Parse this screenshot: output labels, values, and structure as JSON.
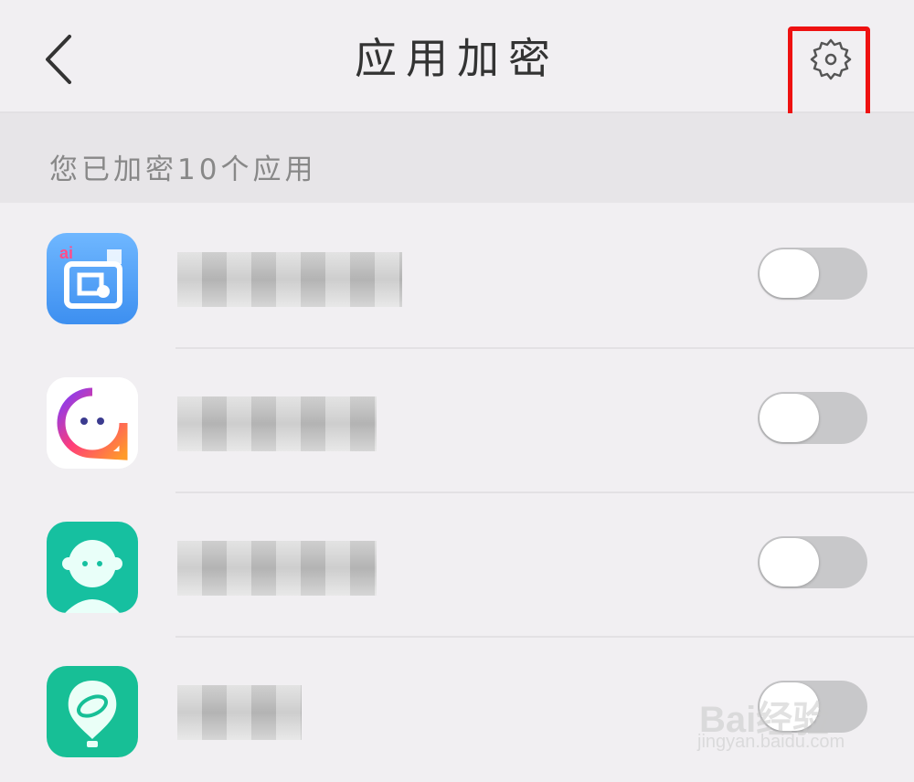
{
  "header": {
    "title": "应用加密",
    "back_icon": "chevron-left-icon",
    "settings_icon": "gear-icon"
  },
  "summary": {
    "text": "您已加密10个应用"
  },
  "apps": [
    {
      "icon": "taobao-app-icon",
      "enabled": false
    },
    {
      "icon": "chat-bubble-app-icon",
      "enabled": false
    },
    {
      "icon": "kid-face-app-icon",
      "enabled": false
    },
    {
      "icon": "balloon-app-icon",
      "enabled": false
    }
  ],
  "watermark": {
    "brand": "Bai经验",
    "url": "jingyan.baidu.com"
  },
  "colors": {
    "highlight": "#ee1111",
    "toggle_off": "#c8c8ca"
  }
}
